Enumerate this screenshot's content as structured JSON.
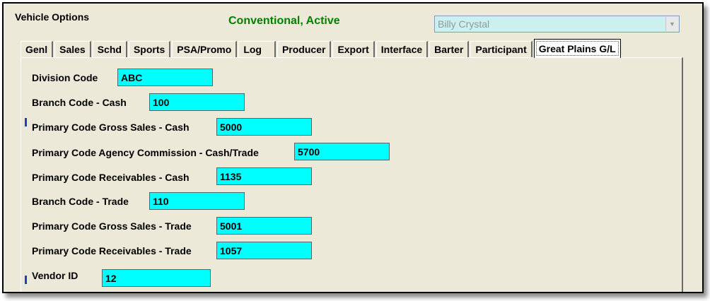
{
  "window": {
    "title": "Vehicle Options",
    "status": "Conventional, Active",
    "selected_person": "Billy Crystal"
  },
  "tabs": [
    {
      "label": "Genl"
    },
    {
      "label": "Sales"
    },
    {
      "label": "Schd"
    },
    {
      "label": "Sports"
    },
    {
      "label": "PSA/Promo"
    },
    {
      "label": "Log"
    },
    {
      "label": "Producer"
    },
    {
      "label": "Export"
    },
    {
      "label": "Interface"
    },
    {
      "label": "Barter"
    },
    {
      "label": "Participant"
    },
    {
      "label": "Great Plains G/L"
    }
  ],
  "active_tab": "Great Plains G/L",
  "fields": {
    "division_code": {
      "label": "Division Code",
      "value": "ABC"
    },
    "branch_code_cash": {
      "label": "Branch Code - Cash",
      "value": "100"
    },
    "primary_gross_sales_cash": {
      "label": "Primary Code Gross Sales - Cash",
      "value": "5000"
    },
    "primary_agency_commission": {
      "label": "Primary Code Agency Commission - Cash/Trade",
      "value": "5700"
    },
    "primary_receivables_cash": {
      "label": "Primary Code Receivables - Cash",
      "value": "1135"
    },
    "branch_code_trade": {
      "label": "Branch Code - Trade",
      "value": "110"
    },
    "primary_gross_sales_trade": {
      "label": "Primary Code Gross Sales - Trade",
      "value": "5001"
    },
    "primary_receivables_trade": {
      "label": "Primary Code Receivables - Trade",
      "value": "1057"
    },
    "vendor_id": {
      "label": "Vendor ID",
      "value": "12"
    }
  },
  "colors": {
    "field_bg": "#00ffff",
    "status_text": "#008000",
    "window_bg": "#ece9d8"
  }
}
